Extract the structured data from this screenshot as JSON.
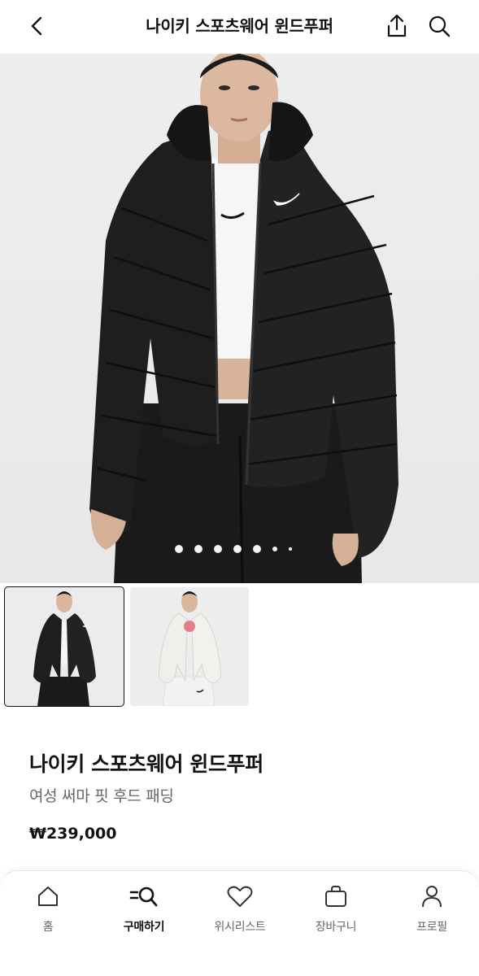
{
  "header": {
    "title": "나이키 스포츠웨어 윈드푸퍼",
    "back_icon": "chevron-left-icon",
    "share_icon": "share-icon",
    "search_icon": "search-icon"
  },
  "gallery": {
    "page_count": 7,
    "active_page": 1
  },
  "product": {
    "name": "나이키 스포츠웨어 윈드푸퍼",
    "subtitle": "여성 써마 핏 후드 패딩",
    "price": "₩239,000"
  },
  "tabbar": {
    "items": [
      {
        "label": "홈",
        "icon": "home-icon",
        "active": false
      },
      {
        "label": "구매하기",
        "icon": "shop-search-icon",
        "active": true
      },
      {
        "label": "위시리스트",
        "icon": "heart-icon",
        "active": false
      },
      {
        "label": "장바구니",
        "icon": "bag-icon",
        "active": false
      },
      {
        "label": "프로필",
        "icon": "person-icon",
        "active": false
      }
    ]
  }
}
